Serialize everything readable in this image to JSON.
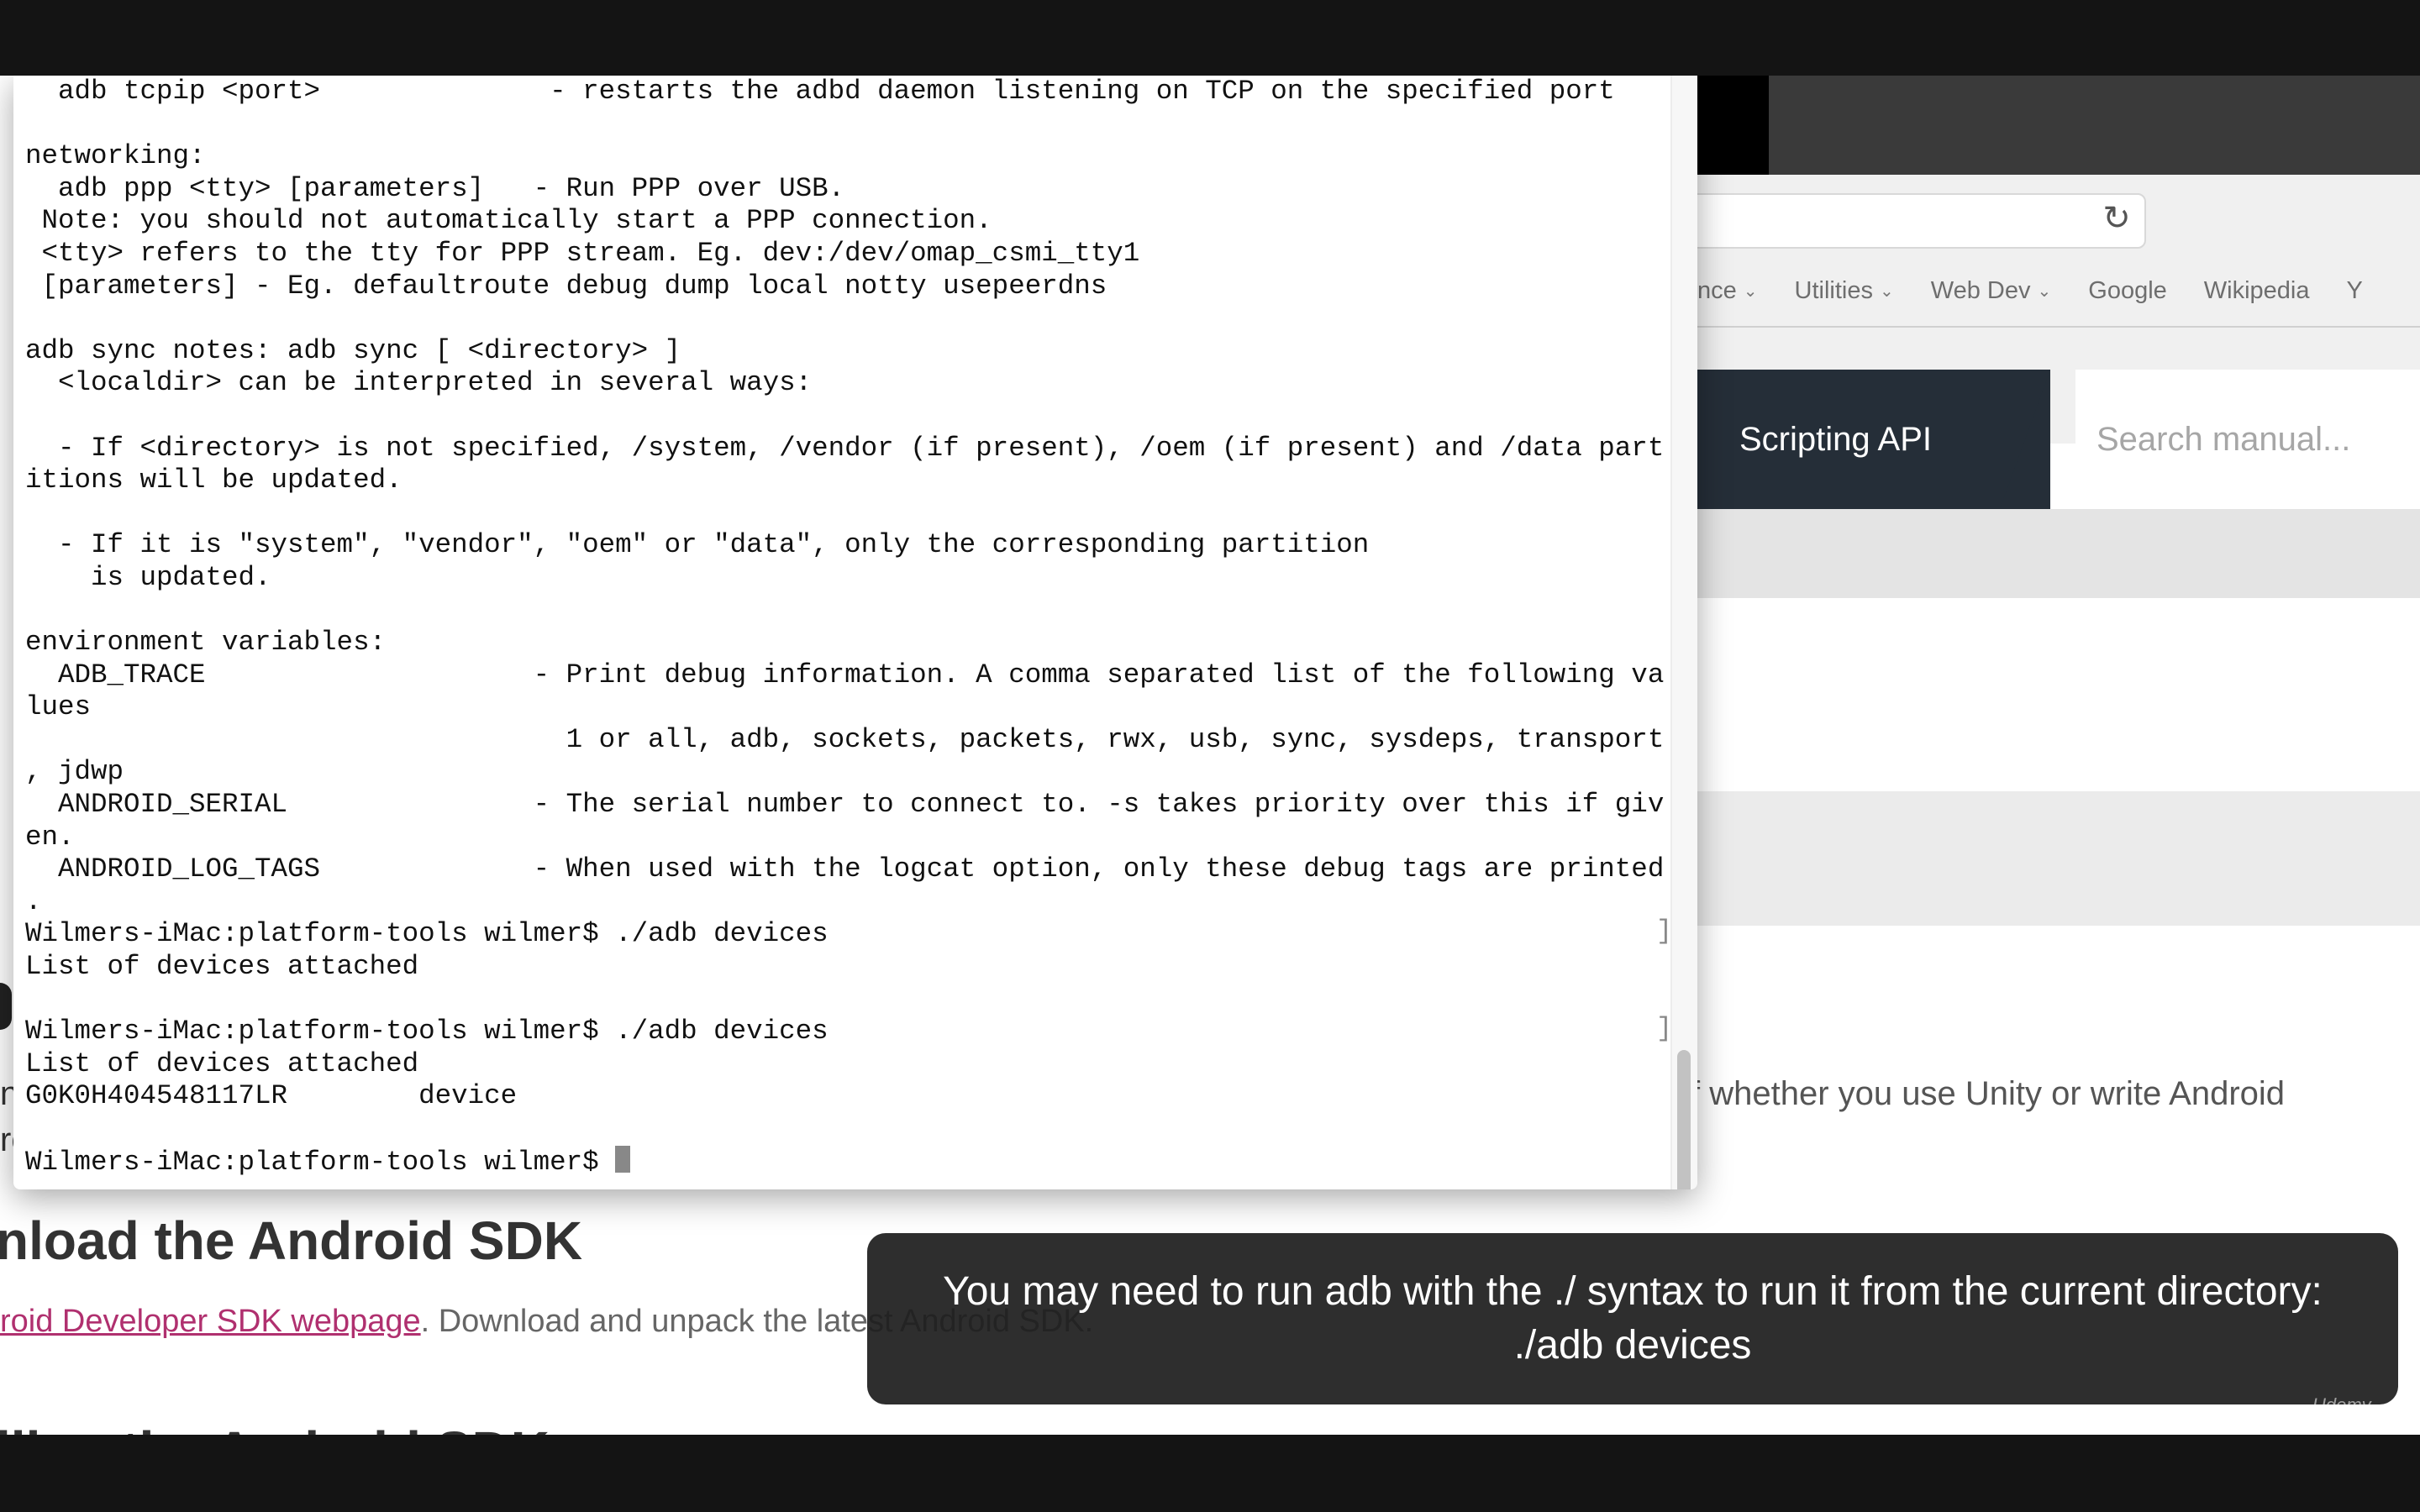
{
  "browser": {
    "bookmarks": [
      "nce",
      "Utilities",
      "Web Dev",
      "Google",
      "Wikipedia",
      "Y"
    ],
    "nav_scripting": "Scripting API",
    "search_placeholder": "Search manual...",
    "paragraph_fragment": "f whether you use Unity or write Android",
    "sdk_heading": "nload the Android SDK",
    "sdk_link": "roid Developer SDK webpage",
    "sdk_text": ". Download and unpack the latest Android SDK.",
    "sdk_heading2": "lling the Android SDK",
    "stray1": "ne",
    "stray2": "ro"
  },
  "terminal": {
    "lines": [
      "  adb tcpip <port>              - restarts the adbd daemon listening on TCP on the specified port",
      "",
      "networking:",
      "  adb ppp <tty> [parameters]   - Run PPP over USB.",
      " Note: you should not automatically start a PPP connection.",
      " <tty> refers to the tty for PPP stream. Eg. dev:/dev/omap_csmi_tty1",
      " [parameters] - Eg. defaultroute debug dump local notty usepeerdns",
      "",
      "adb sync notes: adb sync [ <directory> ]",
      "  <localdir> can be interpreted in several ways:",
      "",
      "  - If <directory> is not specified, /system, /vendor (if present), /oem (if present) and /data part",
      "itions will be updated.",
      "",
      "  - If it is \"system\", \"vendor\", \"oem\" or \"data\", only the corresponding partition",
      "    is updated.",
      "",
      "environment variables:",
      "  ADB_TRACE                    - Print debug information. A comma separated list of the following va",
      "lues",
      "                                 1 or all, adb, sockets, packets, rwx, usb, sync, sysdeps, transport",
      ", jdwp",
      "  ANDROID_SERIAL               - The serial number to connect to. -s takes priority over this if giv",
      "en.",
      "  ANDROID_LOG_TAGS             - When used with the logcat option, only these debug tags are printed",
      ".",
      "Wilmers-iMac:platform-tools wilmer$ ./adb devices",
      "List of devices attached",
      "",
      "Wilmers-iMac:platform-tools wilmer$ ./adb devices",
      "List of devices attached",
      "G0K0H404548117LR        device",
      "",
      "Wilmers-iMac:platform-tools wilmer$ "
    ]
  },
  "caption": {
    "line1": "You may need to run adb with the ./ syntax to run it from the current directory:",
    "line2": "./adb devices"
  },
  "watermark": "Udemy"
}
